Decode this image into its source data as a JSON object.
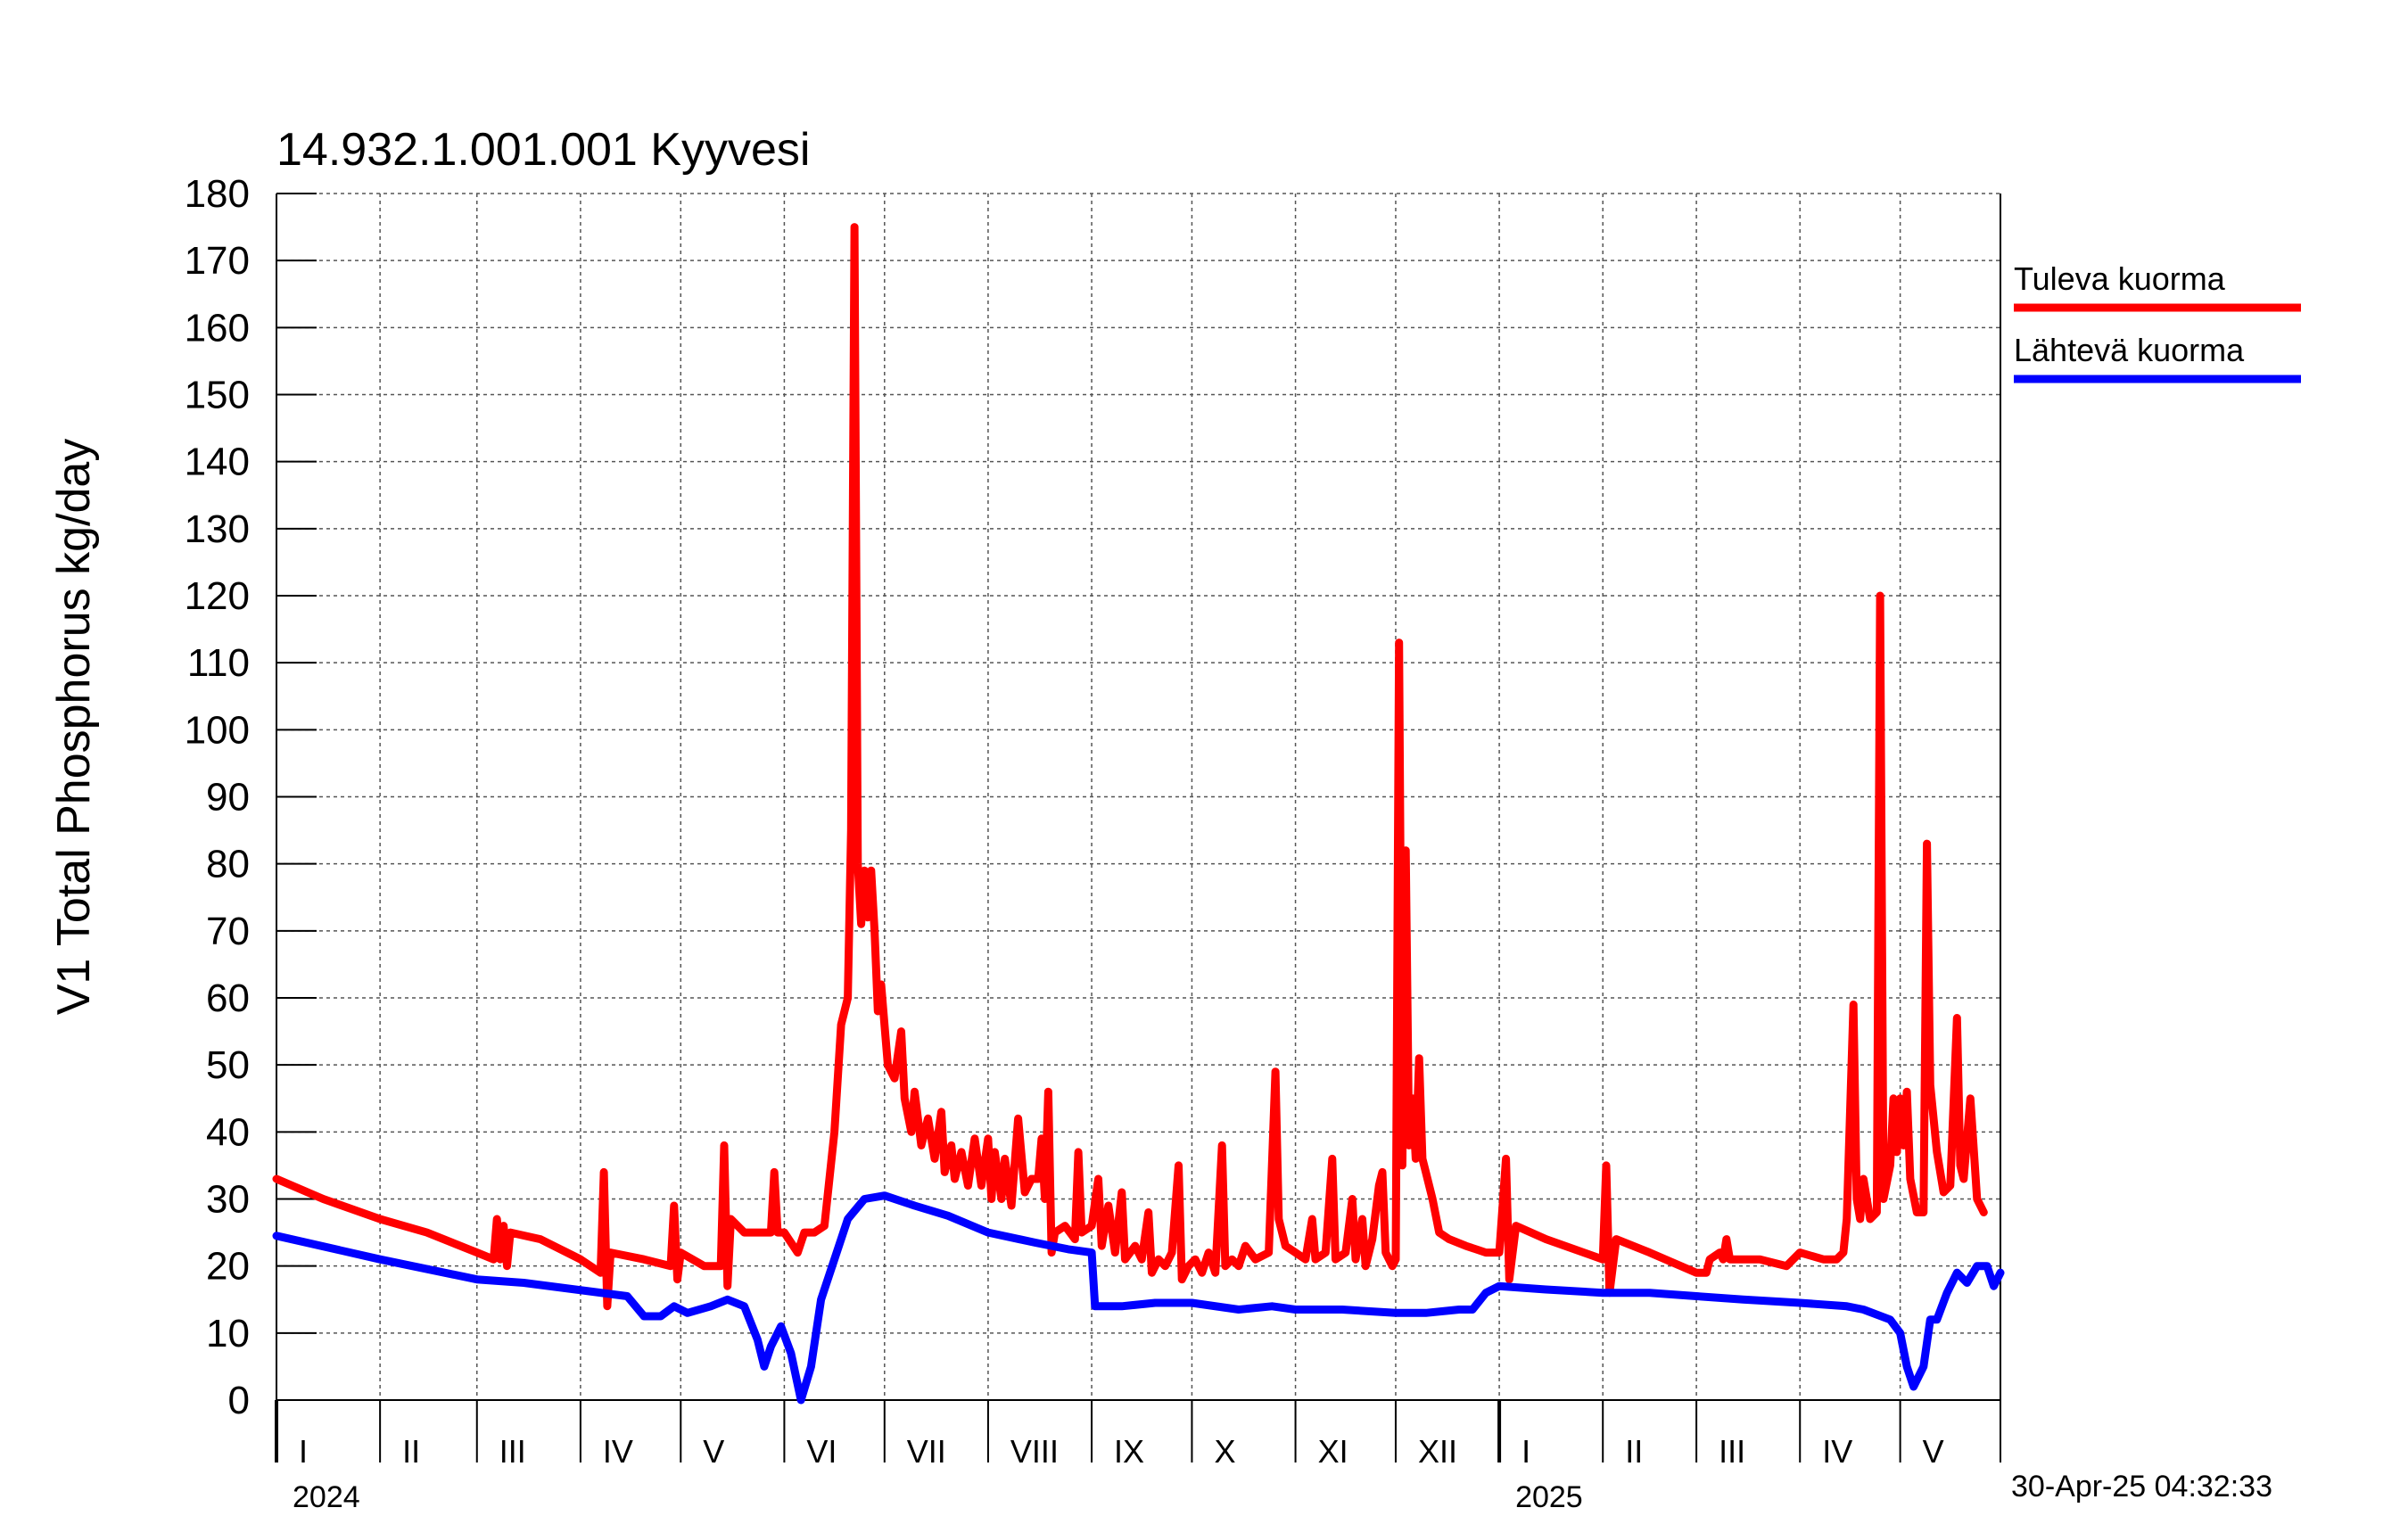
{
  "chart_data": {
    "type": "line",
    "title": "14.932.1.001.001 Kyyvesi",
    "ylabel": "V1 Total Phosphorus kg/day",
    "xlabel": "",
    "ylim": [
      0,
      180
    ],
    "y_ticks": [
      0,
      10,
      20,
      30,
      40,
      50,
      60,
      70,
      80,
      90,
      100,
      110,
      120,
      130,
      140,
      150,
      160,
      170,
      180
    ],
    "x_range": [
      "2024-01-01",
      "2025-05-31"
    ],
    "grid": true,
    "legend_position": "right",
    "month_labels": [
      "I",
      "II",
      "III",
      "IV",
      "V",
      "VI",
      "VII",
      "VIII",
      "IX",
      "X",
      "XI",
      "XII",
      "I",
      "II",
      "III",
      "IV",
      "V"
    ],
    "month_starts": [
      "2024-01-01",
      "2024-02-01",
      "2024-03-01",
      "2024-04-01",
      "2024-05-01",
      "2024-06-01",
      "2024-07-01",
      "2024-08-01",
      "2024-09-01",
      "2024-10-01",
      "2024-11-01",
      "2024-12-01",
      "2025-01-01",
      "2025-02-01",
      "2025-03-01",
      "2025-04-01",
      "2025-05-01"
    ],
    "year_labels": [
      {
        "label": "2024",
        "date": "2024-01-01"
      },
      {
        "label": "2025",
        "date": "2025-01-01"
      }
    ],
    "timestamp": "30-Apr-25 04:32:33",
    "series": [
      {
        "name": "Tuleva kuorma",
        "color": "#ff0000",
        "points": [
          [
            "2024-01-01",
            33
          ],
          [
            "2024-01-15",
            30
          ],
          [
            "2024-02-01",
            27
          ],
          [
            "2024-02-15",
            25
          ],
          [
            "2024-03-01",
            22
          ],
          [
            "2024-03-06",
            21
          ],
          [
            "2024-03-07",
            27
          ],
          [
            "2024-03-08",
            21
          ],
          [
            "2024-03-09",
            26
          ],
          [
            "2024-03-10",
            20
          ],
          [
            "2024-03-11",
            25
          ],
          [
            "2024-03-20",
            24
          ],
          [
            "2024-04-01",
            21
          ],
          [
            "2024-04-07",
            19
          ],
          [
            "2024-04-08",
            34
          ],
          [
            "2024-04-09",
            14
          ],
          [
            "2024-04-10",
            22
          ],
          [
            "2024-04-20",
            21
          ],
          [
            "2024-04-28",
            20
          ],
          [
            "2024-04-29",
            29
          ],
          [
            "2024-04-30",
            18
          ],
          [
            "2024-05-01",
            22
          ],
          [
            "2024-05-08",
            20
          ],
          [
            "2024-05-13",
            20
          ],
          [
            "2024-05-14",
            38
          ],
          [
            "2024-05-15",
            17
          ],
          [
            "2024-05-16",
            27
          ],
          [
            "2024-05-20",
            25
          ],
          [
            "2024-05-28",
            25
          ],
          [
            "2024-05-29",
            34
          ],
          [
            "2024-05-30",
            25
          ],
          [
            "2024-06-01",
            25
          ],
          [
            "2024-06-05",
            22
          ],
          [
            "2024-06-07",
            25
          ],
          [
            "2024-06-10",
            25
          ],
          [
            "2024-06-13",
            26
          ],
          [
            "2024-06-16",
            40
          ],
          [
            "2024-06-18",
            56
          ],
          [
            "2024-06-20",
            60
          ],
          [
            "2024-06-21",
            85
          ],
          [
            "2024-06-22",
            175
          ],
          [
            "2024-06-23",
            80
          ],
          [
            "2024-06-24",
            71
          ],
          [
            "2024-06-25",
            79
          ],
          [
            "2024-06-26",
            72
          ],
          [
            "2024-06-27",
            79
          ],
          [
            "2024-06-28",
            70
          ],
          [
            "2024-06-29",
            58
          ],
          [
            "2024-06-30",
            62
          ],
          [
            "2024-07-02",
            50
          ],
          [
            "2024-07-04",
            48
          ],
          [
            "2024-07-06",
            55
          ],
          [
            "2024-07-07",
            45
          ],
          [
            "2024-07-09",
            40
          ],
          [
            "2024-07-10",
            46
          ],
          [
            "2024-07-12",
            38
          ],
          [
            "2024-07-14",
            42
          ],
          [
            "2024-07-16",
            36
          ],
          [
            "2024-07-18",
            43
          ],
          [
            "2024-07-19",
            34
          ],
          [
            "2024-07-21",
            38
          ],
          [
            "2024-07-22",
            33
          ],
          [
            "2024-07-24",
            37
          ],
          [
            "2024-07-26",
            32
          ],
          [
            "2024-07-28",
            39
          ],
          [
            "2024-07-30",
            32
          ],
          [
            "2024-08-01",
            39
          ],
          [
            "2024-08-02",
            30
          ],
          [
            "2024-08-03",
            37
          ],
          [
            "2024-08-05",
            30
          ],
          [
            "2024-08-06",
            36
          ],
          [
            "2024-08-08",
            29
          ],
          [
            "2024-08-10",
            42
          ],
          [
            "2024-08-12",
            31
          ],
          [
            "2024-08-14",
            33
          ],
          [
            "2024-08-16",
            33
          ],
          [
            "2024-08-17",
            39
          ],
          [
            "2024-08-18",
            30
          ],
          [
            "2024-08-19",
            46
          ],
          [
            "2024-08-20",
            22
          ],
          [
            "2024-08-21",
            25
          ],
          [
            "2024-08-24",
            26
          ],
          [
            "2024-08-27",
            24
          ],
          [
            "2024-08-28",
            37
          ],
          [
            "2024-08-29",
            25
          ],
          [
            "2024-09-01",
            26
          ],
          [
            "2024-09-03",
            33
          ],
          [
            "2024-09-04",
            23
          ],
          [
            "2024-09-06",
            29
          ],
          [
            "2024-09-08",
            22
          ],
          [
            "2024-09-10",
            31
          ],
          [
            "2024-09-11",
            21
          ],
          [
            "2024-09-14",
            23
          ],
          [
            "2024-09-16",
            21
          ],
          [
            "2024-09-18",
            28
          ],
          [
            "2024-09-19",
            19
          ],
          [
            "2024-09-21",
            21
          ],
          [
            "2024-09-23",
            20
          ],
          [
            "2024-09-25",
            22
          ],
          [
            "2024-09-27",
            35
          ],
          [
            "2024-09-28",
            18
          ],
          [
            "2024-09-30",
            20
          ],
          [
            "2024-10-02",
            21
          ],
          [
            "2024-10-04",
            19
          ],
          [
            "2024-10-06",
            22
          ],
          [
            "2024-10-08",
            19
          ],
          [
            "2024-10-10",
            38
          ],
          [
            "2024-10-11",
            20
          ],
          [
            "2024-10-13",
            21
          ],
          [
            "2024-10-15",
            20
          ],
          [
            "2024-10-17",
            23
          ],
          [
            "2024-10-20",
            21
          ],
          [
            "2024-10-24",
            22
          ],
          [
            "2024-10-26",
            49
          ],
          [
            "2024-10-27",
            27
          ],
          [
            "2024-10-29",
            23
          ],
          [
            "2024-11-01",
            22
          ],
          [
            "2024-11-04",
            21
          ],
          [
            "2024-11-06",
            27
          ],
          [
            "2024-11-07",
            21
          ],
          [
            "2024-11-10",
            22
          ],
          [
            "2024-11-12",
            36
          ],
          [
            "2024-11-13",
            21
          ],
          [
            "2024-11-16",
            22
          ],
          [
            "2024-11-18",
            30
          ],
          [
            "2024-11-19",
            21
          ],
          [
            "2024-11-21",
            27
          ],
          [
            "2024-11-22",
            20
          ],
          [
            "2024-11-24",
            24
          ],
          [
            "2024-11-26",
            32
          ],
          [
            "2024-11-27",
            34
          ],
          [
            "2024-11-28",
            22
          ],
          [
            "2024-11-30",
            20
          ],
          [
            "2024-12-01",
            21
          ],
          [
            "2024-12-02",
            113
          ],
          [
            "2024-12-03",
            35
          ],
          [
            "2024-12-04",
            82
          ],
          [
            "2024-12-05",
            38
          ],
          [
            "2024-12-06",
            45
          ],
          [
            "2024-12-07",
            36
          ],
          [
            "2024-12-08",
            51
          ],
          [
            "2024-12-09",
            36
          ],
          [
            "2024-12-10",
            34
          ],
          [
            "2024-12-12",
            30
          ],
          [
            "2024-12-14",
            25
          ],
          [
            "2024-12-17",
            24
          ],
          [
            "2024-12-22",
            23
          ],
          [
            "2024-12-28",
            22
          ],
          [
            "2025-01-01",
            22
          ],
          [
            "2025-01-03",
            36
          ],
          [
            "2025-01-04",
            18
          ],
          [
            "2025-01-06",
            26
          ],
          [
            "2025-01-15",
            24
          ],
          [
            "2025-02-01",
            21
          ],
          [
            "2025-02-02",
            35
          ],
          [
            "2025-02-03",
            16
          ],
          [
            "2025-02-05",
            24
          ],
          [
            "2025-02-15",
            22
          ],
          [
            "2025-03-01",
            19
          ],
          [
            "2025-03-04",
            19
          ],
          [
            "2025-03-05",
            21
          ],
          [
            "2025-03-08",
            22
          ],
          [
            "2025-03-09",
            21
          ],
          [
            "2025-03-10",
            24
          ],
          [
            "2025-03-11",
            21
          ],
          [
            "2025-03-20",
            21
          ],
          [
            "2025-03-28",
            20
          ],
          [
            "2025-04-01",
            22
          ],
          [
            "2025-04-08",
            21
          ],
          [
            "2025-04-12",
            21
          ],
          [
            "2025-04-14",
            22
          ],
          [
            "2025-04-15",
            27
          ],
          [
            "2025-04-17",
            59
          ],
          [
            "2025-04-18",
            30
          ],
          [
            "2025-04-19",
            27
          ],
          [
            "2025-04-20",
            33
          ],
          [
            "2025-04-22",
            27
          ],
          [
            "2025-04-24",
            28
          ],
          [
            "2025-04-25",
            120
          ],
          [
            "2025-04-26",
            30
          ],
          [
            "2025-04-28",
            35
          ],
          [
            "2025-04-29",
            45
          ],
          [
            "2025-04-30",
            37
          ],
          [
            "2025-05-01",
            45
          ],
          [
            "2025-05-02",
            38
          ],
          [
            "2025-05-03",
            46
          ],
          [
            "2025-05-04",
            33
          ],
          [
            "2025-05-06",
            28
          ],
          [
            "2025-05-08",
            28
          ],
          [
            "2025-05-09",
            83
          ],
          [
            "2025-05-10",
            47
          ],
          [
            "2025-05-12",
            37
          ],
          [
            "2025-05-14",
            31
          ],
          [
            "2025-05-16",
            32
          ],
          [
            "2025-05-18",
            57
          ],
          [
            "2025-05-19",
            35
          ],
          [
            "2025-05-20",
            33
          ],
          [
            "2025-05-22",
            45
          ],
          [
            "2025-05-24",
            30
          ],
          [
            "2025-05-26",
            28
          ]
        ]
      },
      {
        "name": "Lähtevä kuorma",
        "color": "#0000ff",
        "points": [
          [
            "2024-01-01",
            24.5
          ],
          [
            "2024-02-01",
            21
          ],
          [
            "2024-03-01",
            18
          ],
          [
            "2024-03-15",
            17.5
          ],
          [
            "2024-04-15",
            15.5
          ],
          [
            "2024-04-20",
            12.5
          ],
          [
            "2024-04-25",
            12.5
          ],
          [
            "2024-04-29",
            14
          ],
          [
            "2024-05-03",
            13
          ],
          [
            "2024-05-10",
            14
          ],
          [
            "2024-05-15",
            15
          ],
          [
            "2024-05-20",
            14
          ],
          [
            "2024-05-24",
            9
          ],
          [
            "2024-05-26",
            5
          ],
          [
            "2024-05-28",
            8
          ],
          [
            "2024-05-31",
            11
          ],
          [
            "2024-06-03",
            7
          ],
          [
            "2024-06-06",
            0
          ],
          [
            "2024-06-09",
            5
          ],
          [
            "2024-06-12",
            15
          ],
          [
            "2024-06-16",
            21
          ],
          [
            "2024-06-20",
            27
          ],
          [
            "2024-06-25",
            30
          ],
          [
            "2024-07-01",
            30.5
          ],
          [
            "2024-07-10",
            29
          ],
          [
            "2024-07-20",
            27.5
          ],
          [
            "2024-08-01",
            25
          ],
          [
            "2024-08-15",
            23.5
          ],
          [
            "2024-08-25",
            22.5
          ],
          [
            "2024-09-01",
            22
          ],
          [
            "2024-09-02",
            14
          ],
          [
            "2024-09-10",
            14
          ],
          [
            "2024-09-20",
            14.5
          ],
          [
            "2024-10-01",
            14.5
          ],
          [
            "2024-10-15",
            13.5
          ],
          [
            "2024-10-25",
            14
          ],
          [
            "2024-11-01",
            13.5
          ],
          [
            "2024-11-15",
            13.5
          ],
          [
            "2024-12-01",
            13
          ],
          [
            "2024-12-10",
            13
          ],
          [
            "2024-12-20",
            13.5
          ],
          [
            "2024-12-24",
            13.5
          ],
          [
            "2024-12-28",
            16
          ],
          [
            "2025-01-01",
            17
          ],
          [
            "2025-01-15",
            16.5
          ],
          [
            "2025-02-01",
            16
          ],
          [
            "2025-02-15",
            16
          ],
          [
            "2025-03-01",
            15.5
          ],
          [
            "2025-03-15",
            15
          ],
          [
            "2025-04-01",
            14.5
          ],
          [
            "2025-04-15",
            14
          ],
          [
            "2025-04-20",
            13.5
          ],
          [
            "2025-04-28",
            12
          ],
          [
            "2025-05-01",
            10
          ],
          [
            "2025-05-03",
            5
          ],
          [
            "2025-05-05",
            2
          ],
          [
            "2025-05-08",
            5
          ],
          [
            "2025-05-10",
            12
          ],
          [
            "2025-05-12",
            12
          ],
          [
            "2025-05-15",
            16
          ],
          [
            "2025-05-18",
            19
          ],
          [
            "2025-05-21",
            17.5
          ],
          [
            "2025-05-24",
            20
          ],
          [
            "2025-05-27",
            20
          ],
          [
            "2025-05-29",
            17
          ],
          [
            "2025-05-31",
            19
          ]
        ]
      }
    ]
  }
}
